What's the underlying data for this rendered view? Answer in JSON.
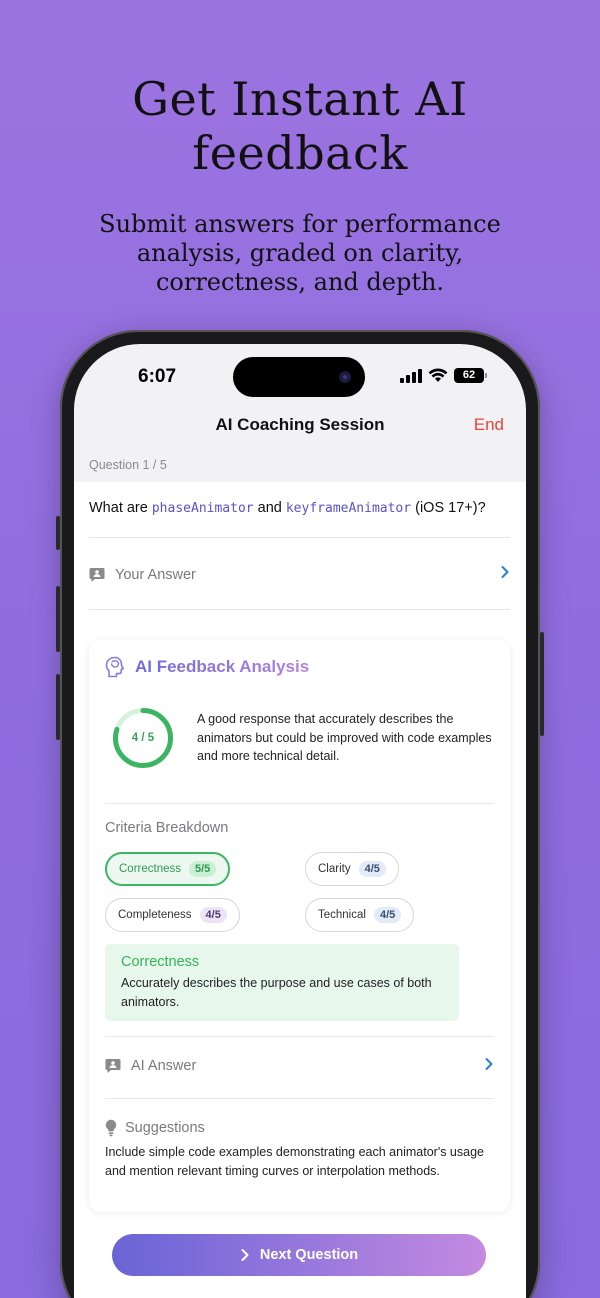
{
  "hero": {
    "title_line1": "Get Instant AI",
    "title_line2": "feedback",
    "subtitle_line1": "Submit answers for performance",
    "subtitle_line2": "analysis, graded on clarity,",
    "subtitle_line3": "correctness, and depth."
  },
  "status_bar": {
    "time": "6:07",
    "battery": "62"
  },
  "nav": {
    "title": "AI Coaching Session",
    "end_label": "End"
  },
  "question": {
    "counter": "Question 1 / 5",
    "prefix": "What are ",
    "code1": "phaseAnimator",
    "middle": " and ",
    "code2": "keyframeAnimator",
    "suffix": " (iOS 17+)?"
  },
  "your_answer": {
    "label": "Your Answer"
  },
  "feedback": {
    "title": "AI Feedback Analysis",
    "score_label": "4 / 5",
    "score_value": 4,
    "score_max": 5,
    "summary": "A good response that accurately describes the animators but could be improved with code examples and more technical detail.",
    "criteria_label": "Criteria Breakdown",
    "criteria": [
      {
        "name": "Correctness",
        "score": "5/5"
      },
      {
        "name": "Clarity",
        "score": "4/5"
      },
      {
        "name": "Completeness",
        "score": "4/5"
      },
      {
        "name": "Technical",
        "score": "4/5"
      }
    ],
    "detail_title": "Correctness",
    "detail_text": "Accurately describes the purpose and use cases of both animators.",
    "ai_answer_label": "AI Answer",
    "suggestions_label": "Suggestions",
    "suggestions_text": "Include simple code examples demonstrating each animator's usage and mention relevant timing curves or interpolation methods."
  },
  "next_button": {
    "label": "Next Question"
  },
  "colors": {
    "background": "#9272df",
    "accent_green": "#3cb562",
    "end_red": "#e5453a",
    "chevron_blue": "#2a7fd8"
  }
}
